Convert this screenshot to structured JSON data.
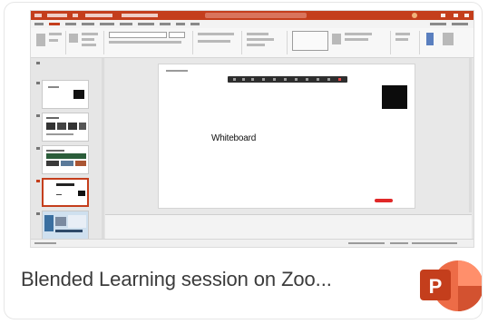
{
  "file_card": {
    "title": "Blended Learning session on Zoo...",
    "app_icon": "powerpoint-icon",
    "app_icon_letter": "P",
    "accent_color": "#c43e1c"
  },
  "slide_preview": {
    "main_slide_text": "Whiteboard"
  },
  "colors": {
    "ppt_orange": "#c43e1c",
    "ppt_icon_dark": "#c43e1c",
    "ppt_icon_light": "#ed6c47"
  }
}
